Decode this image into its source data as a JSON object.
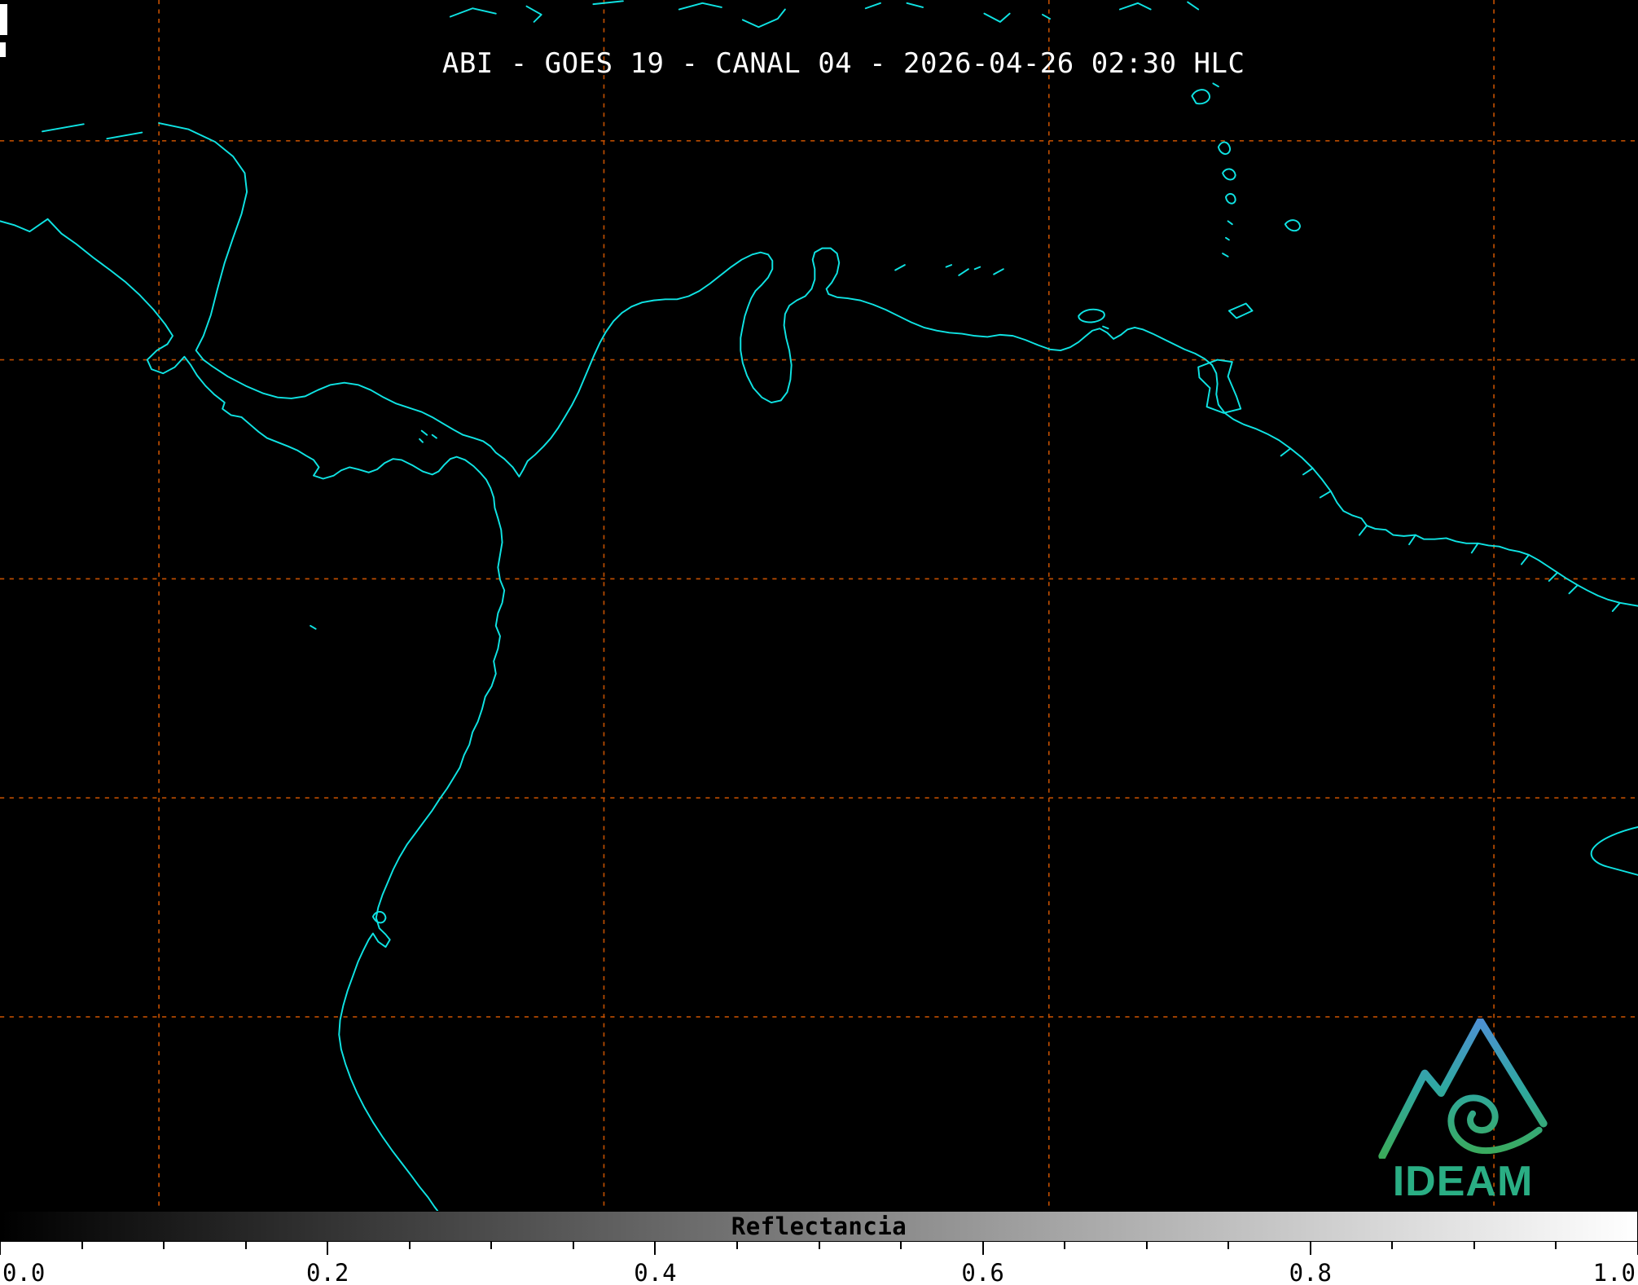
{
  "title": "ABI - GOES 19 - CANAL 04 - 2026-04-26 02:30 HLC",
  "map": {
    "background": "#000000",
    "coastline_color": "#0FE3E3",
    "grid_color": "#C85200",
    "title_color": "#FFFFFF"
  },
  "colorbar": {
    "label": "Reflectancia",
    "min": "0.0",
    "max": "1.0",
    "ticks": [
      "0.0",
      "0.2",
      "0.4",
      "0.6",
      "0.8",
      "1.0"
    ],
    "gradient_start": "#000000",
    "gradient_end": "#FFFFFF"
  },
  "logo": {
    "text": "IDEAM",
    "color_top": "#4E8FD4",
    "color_mid": "#2FA8A0",
    "color_bottom": "#3BAA58",
    "text_color": "#2AAE84"
  }
}
